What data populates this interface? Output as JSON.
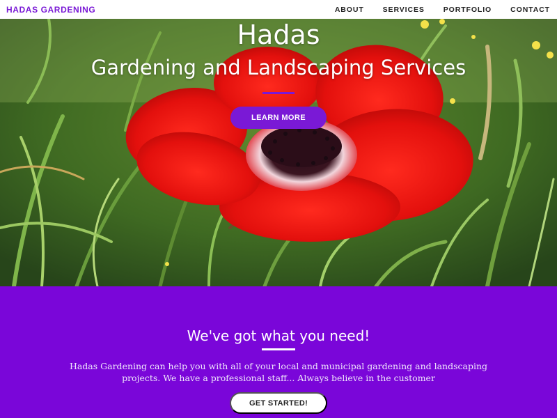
{
  "navbar": {
    "brand": "HADAS GARDENING",
    "links": [
      "ABOUT",
      "SERVICES",
      "PORTFOLIO",
      "CONTACT"
    ]
  },
  "hero": {
    "title": "Hadas",
    "subtitle": "Gardening and Landscaping Services",
    "button_label": "LEARN MORE"
  },
  "services": {
    "heading": "We've got what you need!",
    "text": "Hadas Gardening can help you with all of your local and municipal gardening and landscaping projects. We have a professional staff... Always believe in the customer",
    "button_label": "GET STARTED!"
  },
  "colors": {
    "accent": "#7a19d6",
    "section_background": "#7a06d9",
    "flower_red": "#e8110f"
  }
}
